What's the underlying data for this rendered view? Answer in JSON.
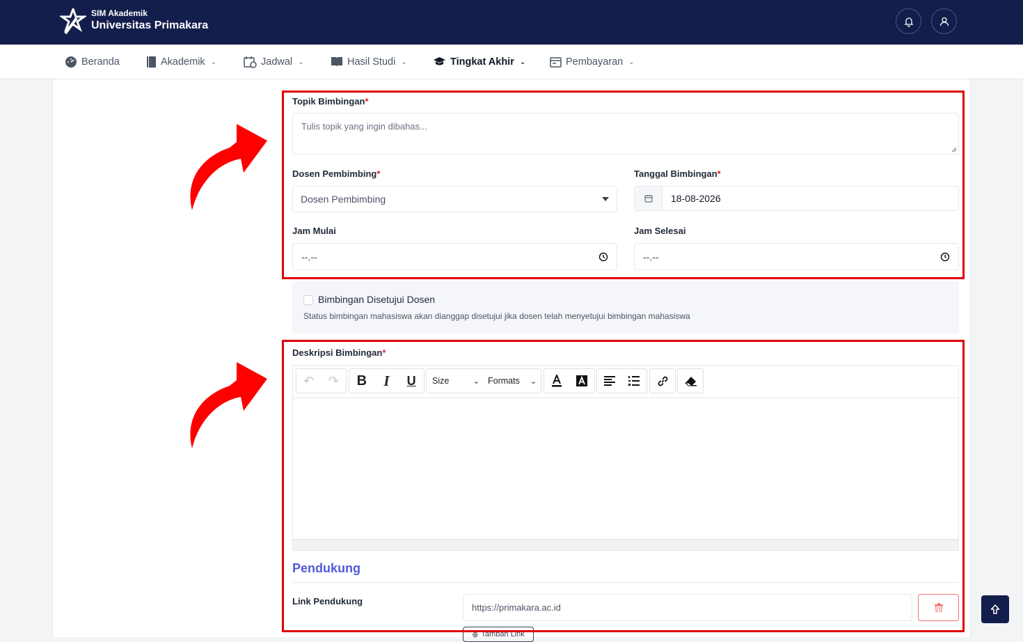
{
  "header": {
    "app_small": "SIM Akademik",
    "app_name": "Universitas Primakara",
    "icons": [
      "bell-icon",
      "user-icon"
    ]
  },
  "nav": {
    "items": [
      {
        "label": "Beranda",
        "icon": "dashboard-icon",
        "has_dropdown": false
      },
      {
        "label": "Akademik",
        "icon": "book-icon",
        "has_dropdown": true
      },
      {
        "label": "Jadwal",
        "icon": "calendar-clock-icon",
        "has_dropdown": true
      },
      {
        "label": "Hasil Studi",
        "icon": "open-book-icon",
        "has_dropdown": true
      },
      {
        "label": "Tingkat Akhir",
        "icon": "graduation-cap-icon",
        "has_dropdown": true,
        "active": true
      },
      {
        "label": "Pembayaran",
        "icon": "invoice-icon",
        "has_dropdown": true
      }
    ]
  },
  "form": {
    "topik": {
      "label": "Topik Bimbingan",
      "required": "*",
      "placeholder": "Tulis topik yang ingin dibahas..."
    },
    "dosen": {
      "label": "Dosen Pembimbing",
      "required": "*",
      "selected": "Dosen Pembimbing"
    },
    "tanggal": {
      "label": "Tanggal Bimbingan",
      "required": "*",
      "value": "18-08-2026"
    },
    "jam_mulai": {
      "label": "Jam Mulai",
      "value": "--.--"
    },
    "jam_selesai": {
      "label": "Jam Selesai",
      "value": "--.--"
    },
    "approval": {
      "label": "Bimbingan Disetujui Dosen",
      "help": "Status bimbingan mahasiswa akan dianggap disetujui jika dosen telah menyetujui bimbingan mahasiswa"
    },
    "deskripsi": {
      "label": "Deskripsi Bimbingan",
      "required": "*"
    },
    "toolbar": {
      "size_label": "Size",
      "formats_label": "Formats"
    },
    "pendukung": {
      "title": "Pendukung",
      "link_label": "Link Pendukung",
      "link_placeholder": "https://primakara.ac.id",
      "add_link_label": "Tambah Link"
    }
  },
  "colors": {
    "header_bg": "#141e4c",
    "accent": "#4f5bd5",
    "required": "#dc2626",
    "highlight": "#e00000"
  }
}
